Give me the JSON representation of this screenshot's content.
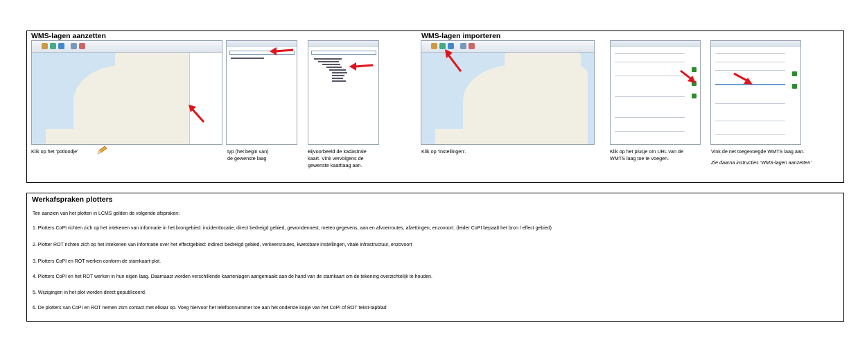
{
  "section_top": {
    "enable": {
      "heading": "WMS-lagen aanzetten",
      "caption_1": "Klik op het 'potloodje'",
      "caption_2": [
        "typ (het begin van)",
        "de gewenste laag"
      ],
      "caption_3": [
        "Bijvoorbeeld de kadastrale",
        "kaart. Vink vervolgens de",
        "gewenste kaartlaag aan."
      ]
    },
    "import": {
      "heading": "WMS-lagen importeren",
      "caption_1": "Klik op 'Instellingen'.",
      "caption_2": [
        "Klik op het plusje om URL van de",
        "WMTS laag toe te voegen."
      ],
      "caption_3": "Vink de net toegevoegde WMTS laag aan.",
      "caption_3_note": "Zie daarna instructies 'WMS-lagen aanzetten'"
    }
  },
  "section_bottom": {
    "heading": "Werkafspraken plotters",
    "intro": "Ten aanzien van het plotten in LCMS gelden de volgende afspraken:",
    "rules": [
      "1. Plotters CoPI richten zich op het intekenen van informatie in het brongebied: incidentlocatie, direct bedreigd gebied, gewondennest, meteo gegevens, aan en afvoerroutes, afzettingen, enzovoort. (leider CoPI bepaalt het bron / effect gebied)",
      "2. Plotter ROT richten zich op het intekenen van informatie over het effectgebied: indirect bedreigd gebied, verkeersroutes, kwetsbare instellingen, vitale infrastructuur, enzovoort",
      "3. Plotters CoPI en ROT werken conform de stamkaart-plot.",
      "4. Plotters CoPI en het ROT werken in hun eigen laag. Daarnaast worden verschillende kaartenlagen aangemaakt aan de hand van de stamkaart om de tekening overzichtelijk te houden.",
      "5. Wijzigingen in het plot worden direct gepubliceerd.",
      "6. De plotters van CoPI en ROT nemen zsm contact met elkaar op. Voeg hiervoor het telefoonnummer toe aan het onderste kopje van het CoPI of ROT tekst-tapblad"
    ]
  },
  "colors": {
    "arrow": "#e0141b",
    "border": "#000000",
    "sea": "#cfe3f2",
    "land": "#f1eee3"
  }
}
